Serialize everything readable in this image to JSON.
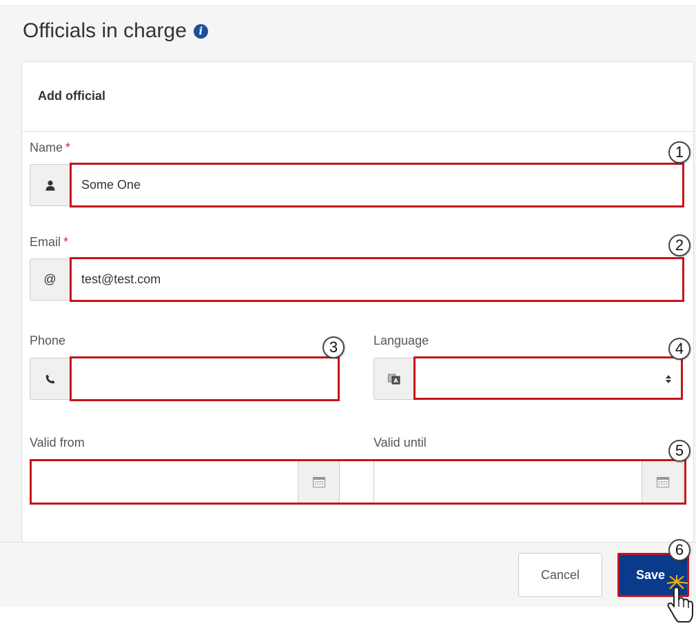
{
  "section": {
    "title": "Officials in charge",
    "info_icon": "info-icon"
  },
  "card": {
    "title": "Add official"
  },
  "fields": {
    "name": {
      "label": "Name",
      "required_mark": "*",
      "value": "Some One",
      "icon": "user-icon"
    },
    "email": {
      "label": "Email",
      "required_mark": "*",
      "value": "test@test.com",
      "addon": "@"
    },
    "phone": {
      "label": "Phone",
      "value": "",
      "icon": "phone-icon"
    },
    "language": {
      "label": "Language",
      "value": "",
      "icon": "language-icon"
    },
    "valid_from": {
      "label": "Valid from",
      "value": "",
      "icon": "calendar-icon"
    },
    "valid_until": {
      "label": "Valid until",
      "value": "",
      "icon": "calendar-icon"
    }
  },
  "callouts": [
    "1",
    "2",
    "3",
    "4",
    "5",
    "6"
  ],
  "buttons": {
    "cancel": "Cancel",
    "save": "Save"
  },
  "colors": {
    "highlight": "#c4141b",
    "save_bg": "#0a3a8c",
    "info_icon": "#1d4f9c",
    "required": "#c7253e"
  }
}
